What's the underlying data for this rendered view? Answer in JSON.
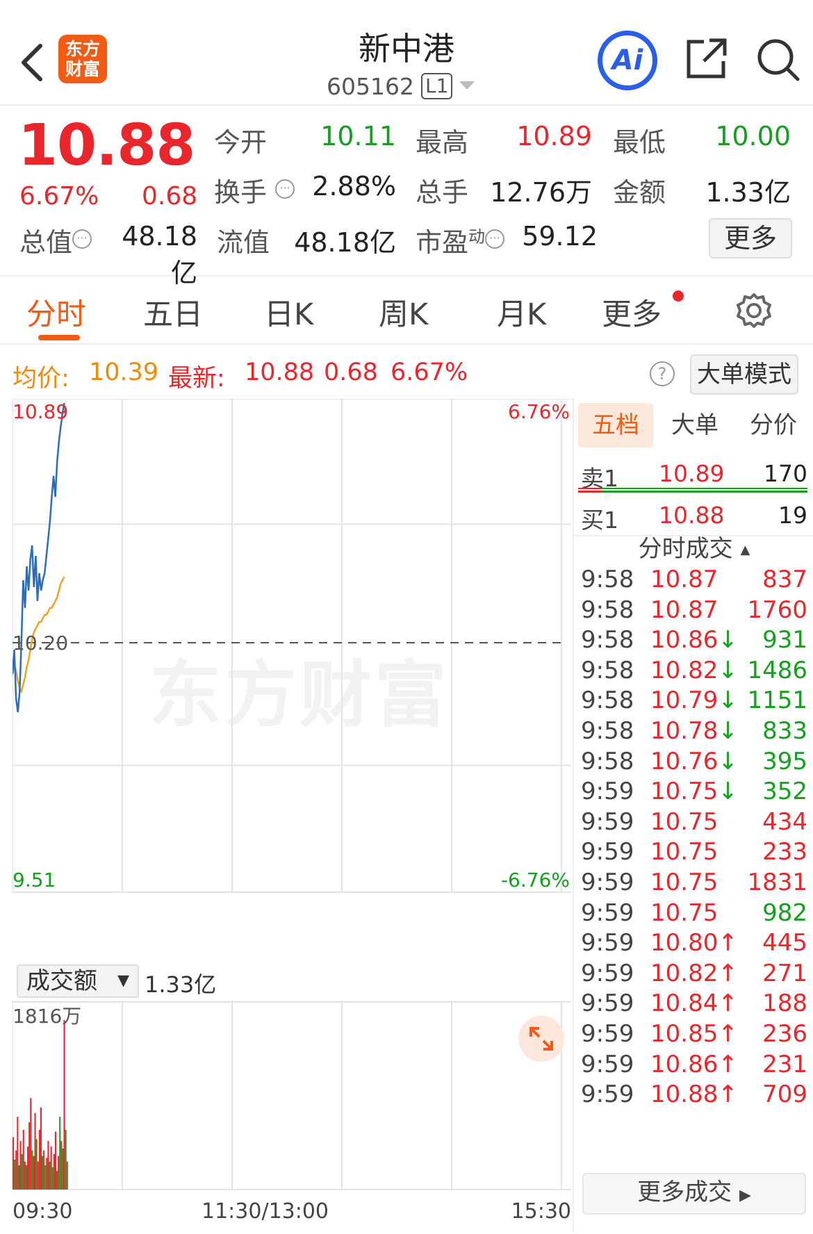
{
  "header": {
    "logo_text_1": "东方",
    "logo_text_2": "财富",
    "stock_name": "新中港",
    "stock_code": "605162",
    "level_badge": "L1",
    "ai_label": "Ai"
  },
  "quote": {
    "last_price": "10.88",
    "change_pct": "6.67%",
    "change_amt": "0.68",
    "fields": [
      {
        "label": "今开",
        "value": "10.11"
      },
      {
        "label": "最高",
        "value": "10.89"
      },
      {
        "label": "最低",
        "value": "10.00"
      },
      {
        "label": "换手",
        "value": "2.88%"
      },
      {
        "label": "总手",
        "value": "12.76万"
      },
      {
        "label": "金额",
        "value": "1.33亿"
      },
      {
        "label": "总值",
        "value": "48.18亿"
      },
      {
        "label": "流值",
        "value": "48.18亿"
      },
      {
        "label": "市盈",
        "label_sup": "动",
        "value": "59.12"
      }
    ],
    "more_label": "更多"
  },
  "tabs": [
    "分时",
    "五日",
    "日K",
    "周K",
    "月K",
    "更多"
  ],
  "info_line": {
    "avg_label": "均价:",
    "avg_value": "10.39",
    "latest_label": "最新:",
    "latest_value": "10.88",
    "latest_change": "0.68",
    "latest_pct": "6.67%",
    "help_icon": "?",
    "big_order_mode": "大单模式"
  },
  "chart_data": {
    "type": "line",
    "title": "",
    "y_max_label": "10.89",
    "y_min_label": "9.51",
    "pct_max_label": "6.76%",
    "pct_min_label": "-6.76%",
    "prev_close_label": "10.20",
    "ylim": [
      9.51,
      10.89
    ],
    "prev_close": 10.2,
    "x_labels": [
      "09:30",
      "11:30/13:00",
      "15:30"
    ],
    "session_minutes": 240,
    "series": [
      {
        "name": "最新",
        "color": "#2a6db8",
        "x": [
          0,
          1,
          2,
          3,
          4,
          5,
          6,
          7,
          8,
          9,
          10,
          11,
          12,
          13,
          14,
          15,
          16,
          17,
          18,
          19,
          20,
          21,
          22,
          23,
          24,
          25,
          26,
          27,
          28,
          29
        ],
        "values": [
          10.11,
          10.18,
          10.04,
          10.0,
          10.06,
          10.2,
          10.38,
          10.3,
          10.42,
          10.35,
          10.44,
          10.48,
          10.36,
          10.45,
          10.32,
          10.4,
          10.35,
          10.38,
          10.4,
          10.45,
          10.5,
          10.55,
          10.62,
          10.68,
          10.62,
          10.72,
          10.78,
          10.82,
          10.86,
          10.89
        ]
      },
      {
        "name": "均价",
        "color": "#f0a21f",
        "x": [
          0,
          1,
          2,
          3,
          4,
          5,
          6,
          7,
          8,
          9,
          10,
          11,
          12,
          13,
          14,
          15,
          16,
          17,
          18,
          19,
          20,
          21,
          22,
          23,
          24,
          25,
          26,
          27,
          28,
          29
        ],
        "values": [
          10.11,
          10.14,
          10.12,
          10.09,
          10.07,
          10.06,
          10.08,
          10.1,
          10.13,
          10.15,
          10.18,
          10.21,
          10.23,
          10.24,
          10.25,
          10.26,
          10.26,
          10.27,
          10.28,
          10.28,
          10.29,
          10.3,
          10.3,
          10.31,
          10.32,
          10.33,
          10.35,
          10.37,
          10.38,
          10.39
        ]
      }
    ],
    "volume": {
      "label": "成交额",
      "total": "1.33亿",
      "max_label": "1816万",
      "max": 1816,
      "bars": [
        560,
        320,
        420,
        780,
        260,
        520,
        380,
        640,
        300,
        260,
        460,
        720,
        980,
        420,
        360,
        820,
        540,
        300,
        640,
        880,
        360,
        420,
        260,
        340,
        520,
        300,
        460,
        240,
        380,
        620,
        200,
        360,
        780,
        520,
        440,
        1816,
        640,
        300
      ],
      "colors": [
        "r",
        "g",
        "r",
        "r",
        "g",
        "r",
        "g",
        "r",
        "r",
        "g",
        "r",
        "r",
        "r",
        "g",
        "r",
        "r",
        "g",
        "r",
        "r",
        "r",
        "g",
        "r",
        "g",
        "r",
        "r",
        "g",
        "r",
        "g",
        "r",
        "r",
        "g",
        "r",
        "g",
        "r",
        "g",
        "r",
        "g",
        "r"
      ]
    }
  },
  "expand_icon": "expand-icon",
  "order_book": {
    "tabs": [
      "五档",
      "大单",
      "分价"
    ],
    "sell": {
      "label": "卖1",
      "price": "10.89",
      "volume": "170"
    },
    "buy": {
      "label": "买1",
      "price": "10.88",
      "volume": "19"
    },
    "buy_ratio": 0.1
  },
  "trades": {
    "title": "分时成交",
    "sort_icon": "▲",
    "rows": [
      {
        "time": "9:58",
        "price": "10.87",
        "arrow": "",
        "vol": "837",
        "pc": "red",
        "vc": "red"
      },
      {
        "time": "9:58",
        "price": "10.87",
        "arrow": "",
        "vol": "1760",
        "pc": "red",
        "vc": "red"
      },
      {
        "time": "9:58",
        "price": "10.86",
        "arrow": "↓",
        "vol": "931",
        "pc": "red",
        "vc": "green"
      },
      {
        "time": "9:58",
        "price": "10.82",
        "arrow": "↓",
        "vol": "1486",
        "pc": "red",
        "vc": "green"
      },
      {
        "time": "9:58",
        "price": "10.79",
        "arrow": "↓",
        "vol": "1151",
        "pc": "red",
        "vc": "green"
      },
      {
        "time": "9:58",
        "price": "10.78",
        "arrow": "↓",
        "vol": "833",
        "pc": "red",
        "vc": "green"
      },
      {
        "time": "9:58",
        "price": "10.76",
        "arrow": "↓",
        "vol": "395",
        "pc": "red",
        "vc": "green"
      },
      {
        "time": "9:59",
        "price": "10.75",
        "arrow": "↓",
        "vol": "352",
        "pc": "red",
        "vc": "green"
      },
      {
        "time": "9:59",
        "price": "10.75",
        "arrow": "",
        "vol": "434",
        "pc": "red",
        "vc": "red"
      },
      {
        "time": "9:59",
        "price": "10.75",
        "arrow": "",
        "vol": "233",
        "pc": "red",
        "vc": "red"
      },
      {
        "time": "9:59",
        "price": "10.75",
        "arrow": "",
        "vol": "1831",
        "pc": "red",
        "vc": "red"
      },
      {
        "time": "9:59",
        "price": "10.75",
        "arrow": "",
        "vol": "982",
        "pc": "red",
        "vc": "green"
      },
      {
        "time": "9:59",
        "price": "10.80",
        "arrow": "↑",
        "vol": "445",
        "pc": "red",
        "vc": "red"
      },
      {
        "time": "9:59",
        "price": "10.82",
        "arrow": "↑",
        "vol": "271",
        "pc": "red",
        "vc": "red"
      },
      {
        "time": "9:59",
        "price": "10.84",
        "arrow": "↑",
        "vol": "188",
        "pc": "red",
        "vc": "red"
      },
      {
        "time": "9:59",
        "price": "10.85",
        "arrow": "↑",
        "vol": "236",
        "pc": "red",
        "vc": "red"
      },
      {
        "time": "9:59",
        "price": "10.86",
        "arrow": "↑",
        "vol": "231",
        "pc": "red",
        "vc": "red"
      },
      {
        "time": "9:59",
        "price": "10.88",
        "arrow": "↑",
        "vol": "709",
        "pc": "red",
        "vc": "red"
      }
    ],
    "more_label": "更多成交"
  },
  "watermark": "东方财富",
  "colors": {
    "up": "#e8262b",
    "down": "#14a01e",
    "accent": "#f35a13",
    "price_line": "#2a6db8",
    "avg_line": "#f0a21f"
  }
}
